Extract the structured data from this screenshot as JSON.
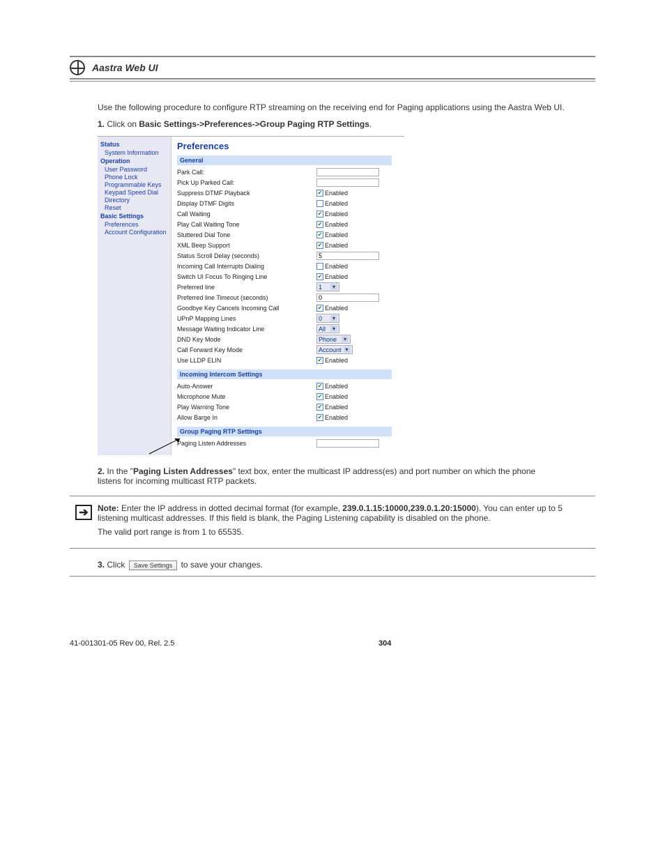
{
  "header": {
    "title": "Aastra Web UI"
  },
  "intro": {
    "line1": "Use the following procedure to configure RTP streaming on the receiving end for Paging applications using the Aastra Web UI.",
    "step1_num": "1.",
    "step1_pre": "Click on ",
    "step1_path": "Basic Settings->Preferences->Group Paging RTP Settings",
    "step1_post": "."
  },
  "shot": {
    "sidebar": {
      "status": "Status",
      "system_info": "System Information",
      "operation": "Operation",
      "user_password": "User Password",
      "phone_lock": "Phone Lock",
      "programmable_keys": "Programmable Keys",
      "keypad_speed_dial": "Keypad Speed Dial",
      "directory": "Directory",
      "reset": "Reset",
      "basic_settings": "Basic Settings",
      "preferences": "Preferences",
      "account_config": "Account Configuration"
    },
    "title": "Preferences",
    "sections": {
      "general": "General",
      "intercom": "Incoming Intercom Settings",
      "paging": "Group Paging RTP Settings"
    },
    "rows": {
      "park_call": "Park Call:",
      "pick_up": "Pick Up Parked Call:",
      "suppress_dtmf": "Suppress DTMF Playback",
      "display_dtmf": "Display DTMF Digits",
      "call_waiting": "Call Waiting",
      "play_cw_tone": "Play Call Waiting Tone",
      "stuttered": "Stuttered Dial Tone",
      "xml_beep": "XML Beep Support",
      "status_scroll": "Status Scroll Delay (seconds)",
      "status_scroll_val": "5",
      "incoming_interrupts": "Incoming Call Interrupts Dialing",
      "switch_ui": "Switch UI Focus To Ringing Line",
      "pref_line": "Preferred line",
      "pref_line_val": "1",
      "pref_line_timeout": "Preferred line Timeout (seconds)",
      "pref_line_timeout_val": "0",
      "goodbye_key": "Goodbye Key Cancels Incoming Call",
      "upnp": "UPnP Mapping Lines",
      "upnp_val": "0",
      "mwi_line": "Message Waiting Indicator Line",
      "mwi_line_val": "All",
      "dnd_mode": "DND Key Mode",
      "dnd_mode_val": "Phone",
      "cfwd_mode": "Call Forward Key Mode",
      "cfwd_mode_val": "Account",
      "lldp": "Use LLDP ELIN",
      "auto_answer": "Auto-Answer",
      "mic_mute": "Microphone Mute",
      "play_warning": "Play Warning Tone",
      "barge_in": "Allow Barge In",
      "paging_addr": "Paging Listen Addresses"
    },
    "enabled_label": "Enabled"
  },
  "step2": {
    "num": "2.",
    "pre": "In the \"",
    "field": "Paging Listen Addresses",
    "mid": "\" text box, enter the multicast IP address(es) and port number on which the phone listens for incoming multicast RTP packets."
  },
  "note": {
    "label": "Note:",
    "body1_pre": "Enter the IP address in dotted decimal format (for example, ",
    "body1_ex": "239.0.1.15:10000,239.0.1.20:15000",
    "body1_post": "). You can enter up to 5 listening multicast addresses. If this field is blank, the Paging Listening capability is disabled on the phone.",
    "body2": "The valid port range is from 1 to 65535."
  },
  "step3": {
    "num": "3.",
    "pre": "Click ",
    "btn": "Save Settings",
    "post": " to save your changes."
  },
  "footer": {
    "left": "41-001301-05 Rev 00, Rel. 2.5",
    "mid": "304"
  }
}
